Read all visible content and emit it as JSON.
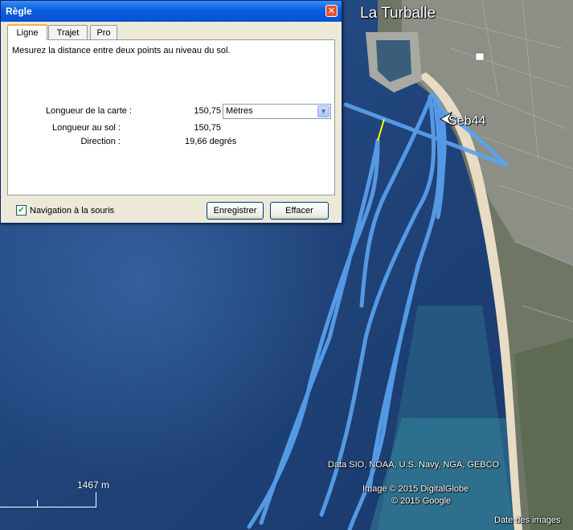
{
  "dialog": {
    "title": "Règle",
    "close_icon": "close-icon",
    "tabs": [
      {
        "label": "Ligne",
        "active": true
      },
      {
        "label": "Trajet",
        "active": false
      },
      {
        "label": "Pro",
        "active": false
      }
    ],
    "description": "Mesurez la distance entre deux points au niveau du sol.",
    "map_length_label": "Longueur de la carte :",
    "map_length_value": "150,75",
    "unit_selected": "Mètres",
    "ground_length_label": "Longueur au sol :",
    "ground_length_value": "150,75",
    "direction_label": "Direction :",
    "direction_value": "19,66 degrés",
    "mouse_nav_label": "Navigation à la souris",
    "mouse_nav_checked": true,
    "save_label": "Enregistrer",
    "clear_label": "Effacer"
  },
  "map": {
    "town_label": "La Turballe",
    "tracker_label": "Seb44",
    "track_color": "#5ba3f0",
    "measure_color": "#ffff00",
    "scale_label": "1467  m",
    "credits": {
      "data": "Data SIO, NOAA, U.S. Navy, NGA, GEBCO",
      "image": "Image © 2015 DigitalGlobe",
      "google": "© 2015 Google",
      "date": "Date des images"
    }
  }
}
